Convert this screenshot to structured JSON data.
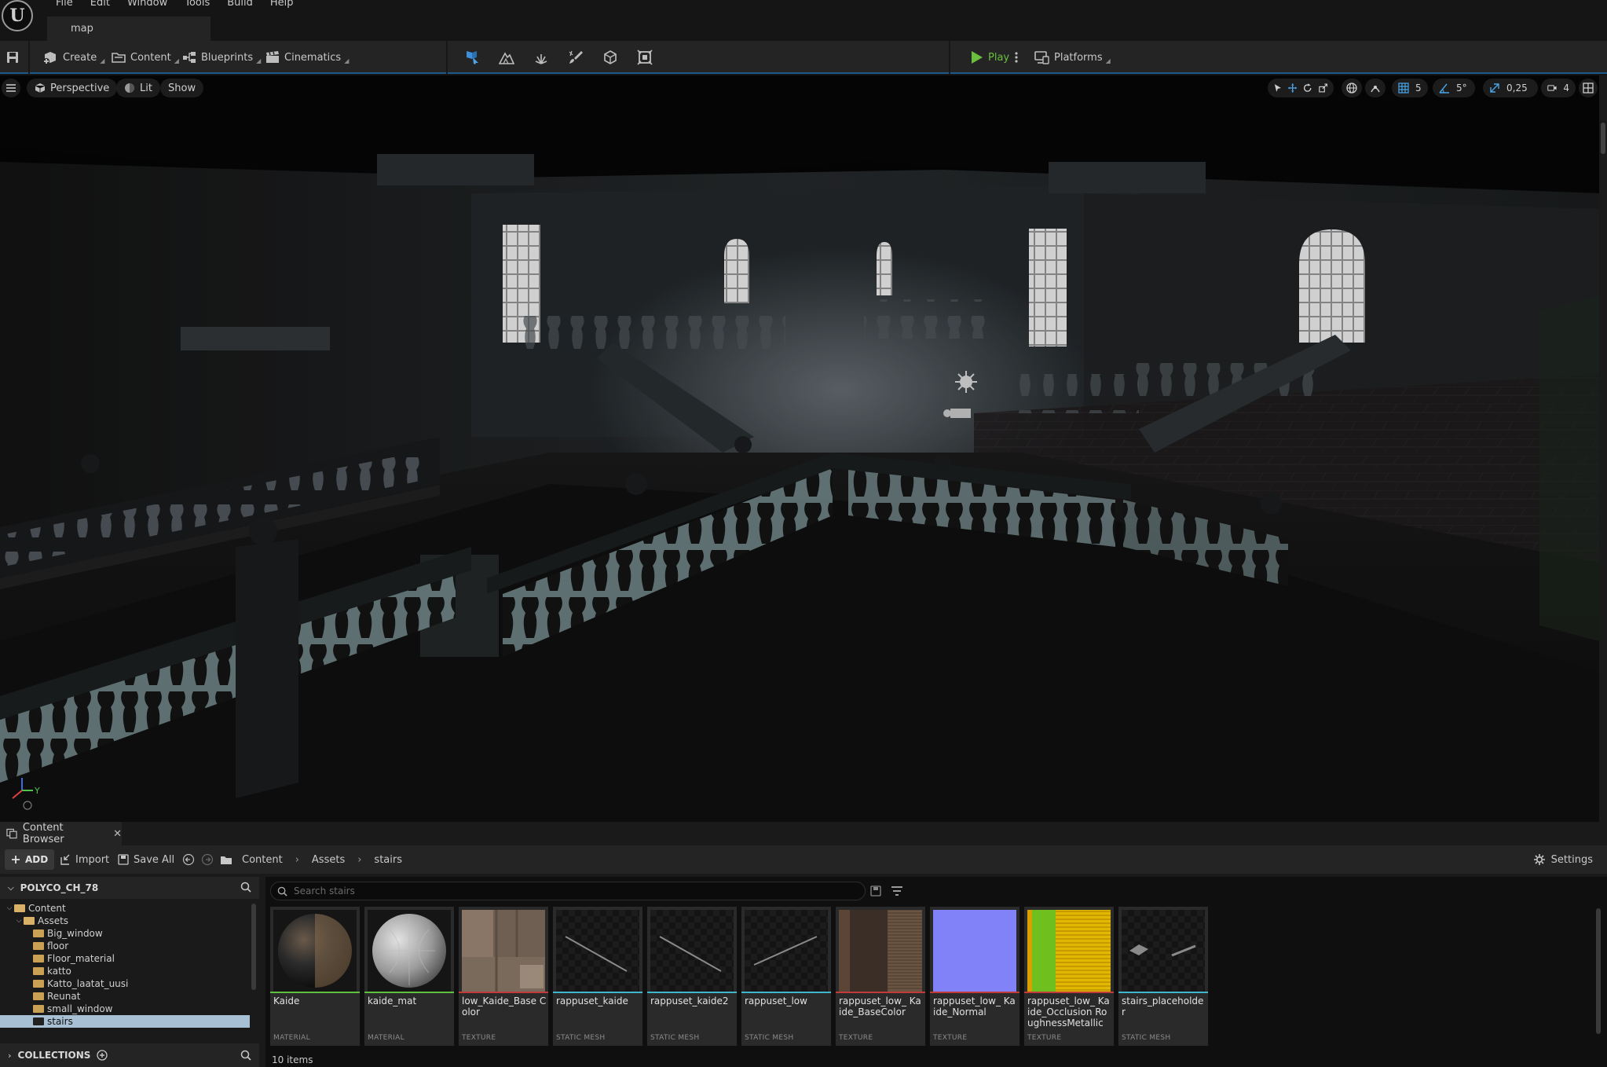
{
  "menu": [
    "File",
    "Edit",
    "Window",
    "Tools",
    "Build",
    "Help"
  ],
  "map_tab": "map",
  "toolbar": {
    "create": "Create",
    "content": "Content",
    "blueprints": "Blueprints",
    "cinematics": "Cinematics",
    "play": "Play",
    "platforms": "Platforms"
  },
  "viewport": {
    "perspective": "Perspective",
    "lit": "Lit",
    "show": "Show",
    "grid_snap": "5",
    "rotation_snap": "5°",
    "scale_snap": "0,25",
    "camera_speed": "4",
    "axis_y": "Y"
  },
  "content_browser": {
    "tab_label": "Content Browser",
    "add": "ADD",
    "import": "Import",
    "save_all": "Save All",
    "breadcrumb": [
      "Content",
      "Assets",
      "stairs"
    ],
    "settings": "Settings",
    "project": "POLYCO_CH_78",
    "tree": [
      {
        "label": "Content",
        "depth": 0,
        "open": true
      },
      {
        "label": "Assets",
        "depth": 1,
        "open": true
      },
      {
        "label": "Big_window",
        "depth": 2
      },
      {
        "label": "floor",
        "depth": 2
      },
      {
        "label": "Floor_material",
        "depth": 2
      },
      {
        "label": "katto",
        "depth": 2
      },
      {
        "label": "Katto_laatat_uusi",
        "depth": 2
      },
      {
        "label": "Reunat",
        "depth": 2
      },
      {
        "label": "small_window",
        "depth": 2
      },
      {
        "label": "stairs",
        "depth": 2,
        "selected": true
      }
    ],
    "collections": "COLLECTIONS",
    "search_placeholder": "Search stairs",
    "item_count": "10 items",
    "assets": [
      {
        "name": "Kaide",
        "type": "MATERIAL",
        "color": "#5fbf3f",
        "thumb": "material-dark"
      },
      {
        "name": "kaide_mat",
        "type": "MATERIAL",
        "color": "#5fbf3f",
        "thumb": "material-grey"
      },
      {
        "name": "low_Kaide_Base Color",
        "type": "TEXTURE",
        "color": "#c23b3b",
        "thumb": "texture-basecolor"
      },
      {
        "name": "rappuset_kaide",
        "type": "STATIC MESH",
        "color": "#3fb6c9",
        "thumb": "mesh-line"
      },
      {
        "name": "rappuset_kaide2",
        "type": "STATIC MESH",
        "color": "#3fb6c9",
        "thumb": "mesh-line"
      },
      {
        "name": "rappuset_low",
        "type": "STATIC MESH",
        "color": "#3fb6c9",
        "thumb": "mesh-line2"
      },
      {
        "name": "rappuset_low_ Kaide_BaseColor",
        "type": "TEXTURE",
        "color": "#c23b3b",
        "thumb": "texture-wood"
      },
      {
        "name": "rappuset_low_ Kaide_Normal",
        "type": "TEXTURE",
        "color": "#c23b3b",
        "thumb": "texture-normal"
      },
      {
        "name": "rappuset_low_ Kaide_Occlusion RoughnessMetallic",
        "type": "TEXTURE",
        "color": "#c23b3b",
        "thumb": "texture-orm"
      },
      {
        "name": "stairs_placeholder",
        "type": "STATIC MESH",
        "color": "#3fb6c9",
        "thumb": "mesh-placeholder"
      }
    ]
  }
}
